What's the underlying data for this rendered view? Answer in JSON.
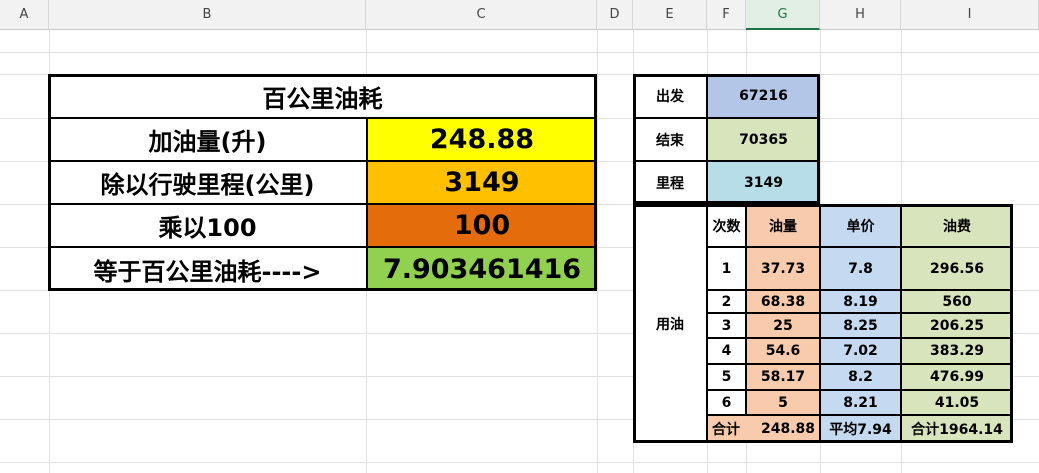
{
  "columns": [
    "A",
    "B",
    "C",
    "D",
    "E",
    "F",
    "G",
    "H",
    "I"
  ],
  "selected_column": "G",
  "colors": {
    "yellow": "#ffff00",
    "orange": "#ffc000",
    "dark_orange": "#e46c0a",
    "green": "#92d050",
    "blue_gray": "#b4c6e7",
    "light_green": "#d8e4bc",
    "light_cyan": "#b7dee8",
    "peach": "#f8cbad",
    "light_blue": "#c5d9f1"
  },
  "summary": {
    "title": "百公里油耗",
    "rows": [
      {
        "label": "加油量(升)",
        "value": "248.88"
      },
      {
        "label": "除以行驶里程(公里)",
        "value": "3149"
      },
      {
        "label": "乘以100",
        "value": "100"
      },
      {
        "label": "等于百公里油耗---->",
        "value": "7.903461416"
      }
    ]
  },
  "odometer": [
    {
      "label": "出发",
      "value": "67216"
    },
    {
      "label": "结束",
      "value": "70365"
    },
    {
      "label": "里程",
      "value": "3149"
    }
  ],
  "fuel": {
    "side_label": "用油",
    "headers": [
      "次数",
      "油量",
      "单价",
      "油费"
    ],
    "rows": [
      [
        "1",
        "37.73",
        "7.8",
        "296.56"
      ],
      [
        "2",
        "68.38",
        "8.19",
        "560"
      ],
      [
        "3",
        "25",
        "8.25",
        "206.25"
      ],
      [
        "4",
        "54.6",
        "7.02",
        "383.29"
      ],
      [
        "5",
        "58.17",
        "8.2",
        "476.99"
      ],
      [
        "6",
        "5",
        "8.21",
        "41.05"
      ]
    ],
    "total_label": "合计",
    "total_amount": "248.88",
    "average_label": "平均7.94",
    "total_cost_label": "合计1964.14"
  }
}
